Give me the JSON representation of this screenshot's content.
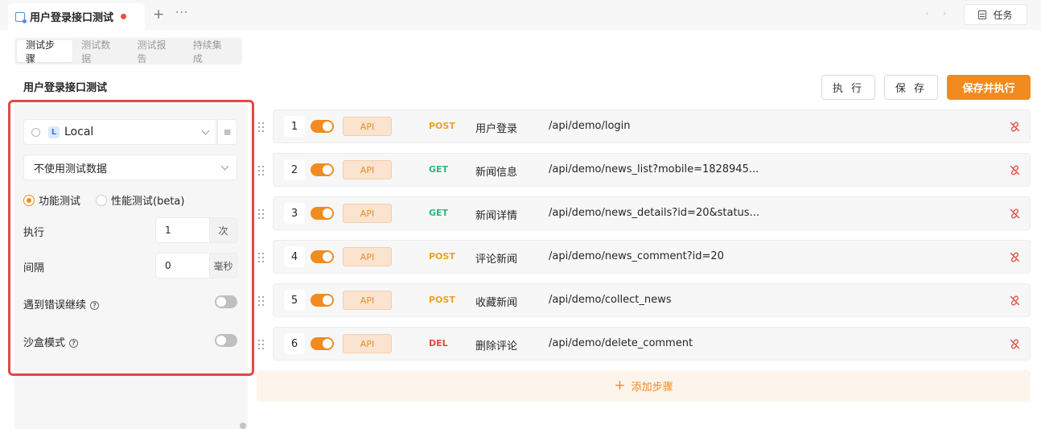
{
  "tab": {
    "title": "用户登录接口测试",
    "add_icon": "+",
    "more_icon": "···"
  },
  "toolbar": {
    "task_label": "任务",
    "prev_icon": "‹",
    "next_icon": "›"
  },
  "subtabs": [
    "测试步骤",
    "测试数据",
    "测试报告",
    "持续集成"
  ],
  "page_title": "用户登录接口测试",
  "actions": {
    "execute": "执 行",
    "save": "保 存",
    "save_execute": "保存并执行"
  },
  "config": {
    "env_badge": "L",
    "env_name": "Local",
    "env_menu_icon": "≡",
    "test_data": "不使用测试数据",
    "mode_functional": "功能测试",
    "mode_performance": "性能测试(beta)",
    "run_label": "执行",
    "run_value": "1",
    "run_unit": "次",
    "interval_label": "间隔",
    "interval_value": "0",
    "interval_unit": "毫秒",
    "continue_on_error": "遇到错误继续",
    "sandbox": "沙盒模式",
    "help_icon": "?"
  },
  "steps": [
    {
      "num": "1",
      "type": "API",
      "method": "POST",
      "name": "用户登录",
      "path": "/api/demo/login"
    },
    {
      "num": "2",
      "type": "API",
      "method": "GET",
      "name": "新闻信息",
      "path": "/api/demo/news_list?mobile=1828945..."
    },
    {
      "num": "3",
      "type": "API",
      "method": "GET",
      "name": "新闻详情",
      "path": "/api/demo/news_details?id=20&status..."
    },
    {
      "num": "4",
      "type": "API",
      "method": "POST",
      "name": "评论新闻",
      "path": "/api/demo/news_comment?id=20"
    },
    {
      "num": "5",
      "type": "API",
      "method": "POST",
      "name": "收藏新闻",
      "path": "/api/demo/collect_news"
    },
    {
      "num": "6",
      "type": "API",
      "method": "DEL",
      "name": "删除评论",
      "path": "/api/demo/delete_comment"
    }
  ],
  "add_step": {
    "icon": "+",
    "label": "添加步骤"
  },
  "colors": {
    "accent": "#f08b1f",
    "post": "#f0a21f",
    "get": "#2db87d",
    "del": "#e04a3f",
    "highlight": "#e64646"
  }
}
